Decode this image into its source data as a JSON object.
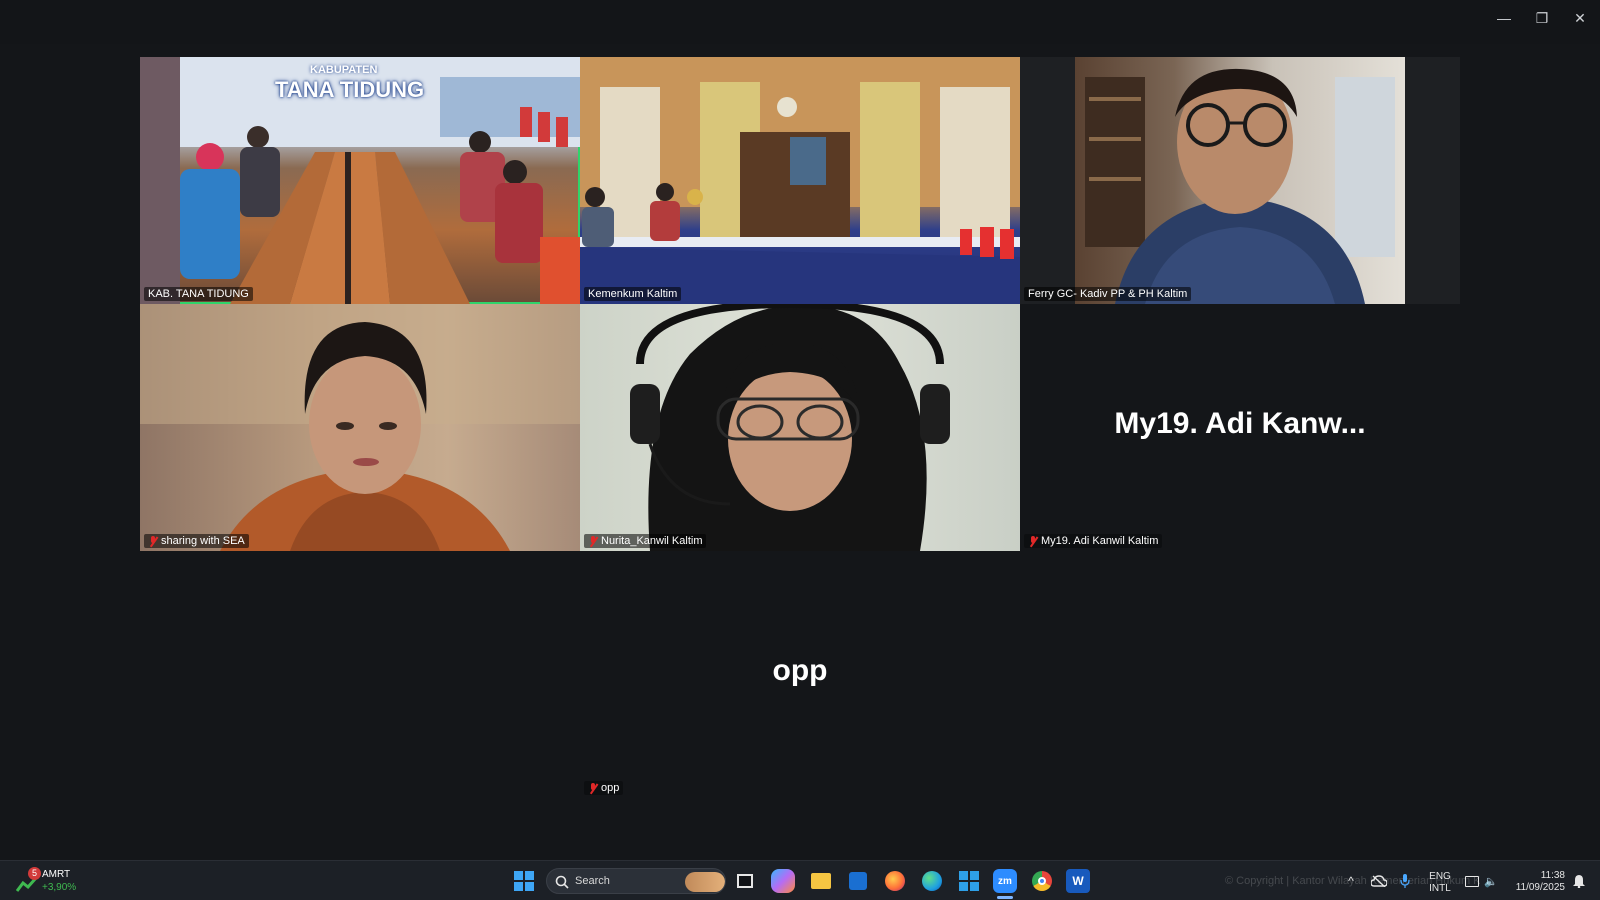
{
  "window": {
    "minimize_glyph": "—",
    "restore_glyph": "❐",
    "close_glyph": "✕"
  },
  "participants": [
    {
      "name": "KAB. TANA TIDUNG",
      "muted": false,
      "active_speaker": true,
      "banner_top": "KABUPATEN",
      "banner_main": "TANA TIDUNG"
    },
    {
      "name": "Kemenkum Kaltim",
      "muted": false
    },
    {
      "name": "Ferry GC- Kadiv PP & PH Kaltim",
      "muted": false
    },
    {
      "name": "sharing with SEA",
      "muted": true
    },
    {
      "name": "Nurita_Kanwil Kaltim",
      "muted": true
    },
    {
      "name": "My19. Adi Kanwil Kaltim",
      "muted": true,
      "display_text": "My19. Adi Kanw..."
    },
    {
      "name": "opp",
      "muted": true,
      "display_text": "opp"
    }
  ],
  "taskbar": {
    "stock_widget": {
      "badge": "5",
      "ticker": "AMRT",
      "change": "+3,90%"
    },
    "search_placeholder": "Search",
    "watermark": "© Copyright | Kantor Wilayah Kementerian Hukum Kalimantan Timur",
    "apps": [
      "windows-start",
      "search",
      "task-view",
      "copilot",
      "file-explorer",
      "microsoft-store",
      "firefox",
      "edge",
      "windows-widget",
      "zoom",
      "chrome",
      "word"
    ],
    "language_top": "ENG",
    "language_bottom": "INTL",
    "time": "11:38",
    "date": "11/09/2025",
    "colors": {
      "zoom": "#2d8cff",
      "word": "#185abd",
      "chrome": "#e8453c",
      "edge": "#1fa1e0",
      "firefox": "#ff7139",
      "explorer": "#f5c542",
      "store": "#1a6fd1",
      "copilot": "#7b6cf6"
    }
  }
}
